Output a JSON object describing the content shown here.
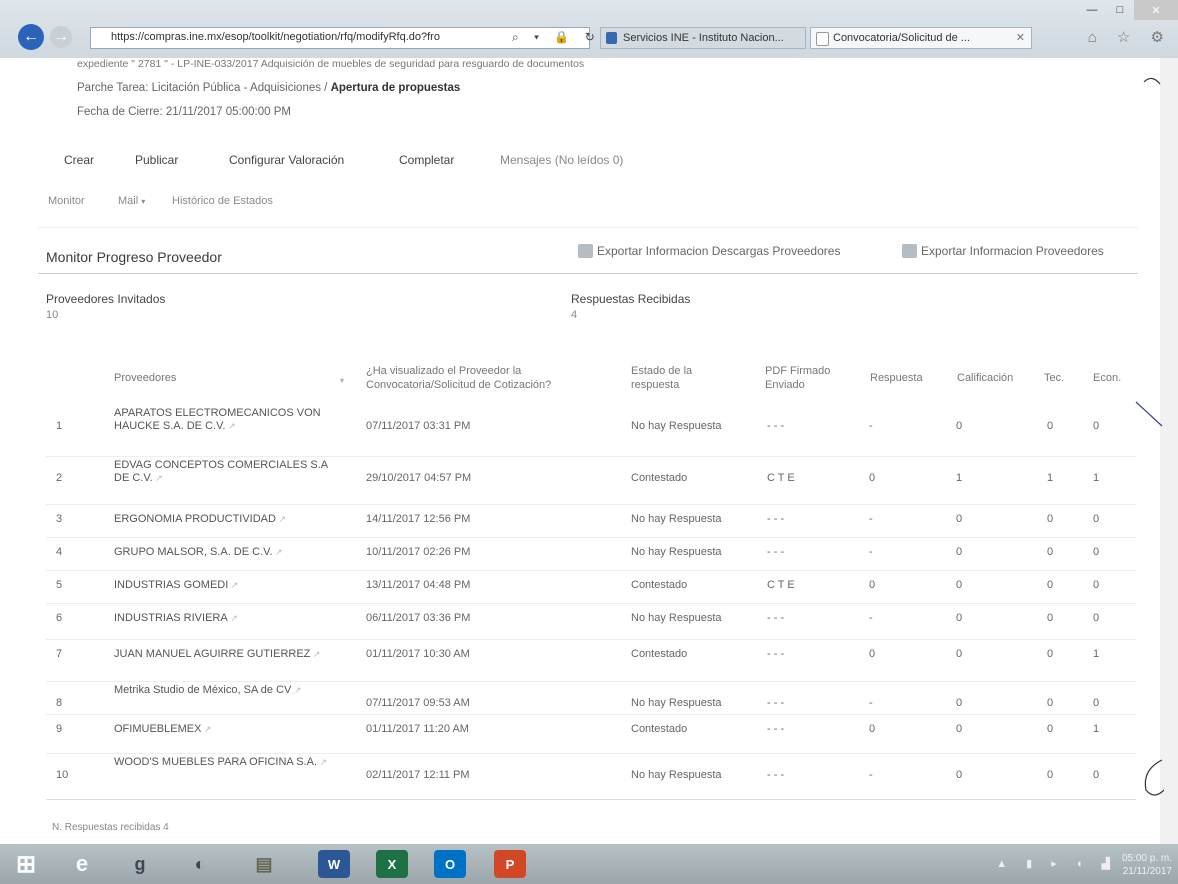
{
  "browser": {
    "url": "https://compras.ine.mx/esop/toolkit/negotiation/rfq/modifyRfq.do?fro",
    "tabs": [
      {
        "label": "Servicios INE - Instituto Nacion..."
      },
      {
        "label": "Convocatoria/Solicitud de ...",
        "close": "✕"
      }
    ],
    "address_controls": "⌕ ▾ 🔒 ↻",
    "toolbar_icons": "⌂ ☆ ⚙"
  },
  "header": {
    "expediente": "expediente \" 2781 \" - LP-INE-033/2017 Adquisición de muebles de seguridad para resguardo de documentos",
    "tarea_prefix": "Parche Tarea: Licitación Pública - Adquisiciones / ",
    "tarea_bold": "Apertura de propuestas",
    "fecha_cierre": "Fecha de Cierre: 21/11/2017 05:00:00 PM"
  },
  "menu": {
    "crear": "Crear",
    "publicar": "Publicar",
    "configurar": "Configurar Valoración",
    "completar": "Completar",
    "mensajes": "Mensajes (No leídos 0)"
  },
  "subnav": {
    "monitor": "Monitor",
    "mail": "Mail",
    "mail_arrow": "▾",
    "historico": "Histórico de Estados"
  },
  "section": {
    "title": "Monitor Progreso Proveedor",
    "export_descargas": "Exportar Informacion Descargas Proveedores",
    "export_proveedores": "Exportar Informacion Proveedores",
    "invitados_label": "Proveedores Invitados",
    "invitados_value": "10",
    "recibidas_label": "Respuestas Recibidas",
    "recibidas_value": "4"
  },
  "table": {
    "headers": {
      "proveedores": "Proveedores",
      "visualizado": "¿Ha visualizado el Proveedor la Convocatoria/Solicitud de Cotización?",
      "estado": "Estado de la respuesta",
      "pdf": "PDF Firmado Enviado",
      "respuesta": "Respuesta",
      "calificacion": "Calificación",
      "tec": "Tec.",
      "econ": "Econ."
    },
    "rows": [
      {
        "n": "1",
        "name": "APARATOS ELECTROMECANICOS VON HAUCKE S.A. DE C.V.",
        "fecha": "07/11/2017 03:31 PM",
        "estado": "No hay Respuesta",
        "pdf": "- - -",
        "resp": "-",
        "calif": "0",
        "tec": "0",
        "econ": "0"
      },
      {
        "n": "2",
        "name": "EDVAG CONCEPTOS COMERCIALES S.A DE C.V.",
        "fecha": "29/10/2017 04:57 PM",
        "estado": "Contestado",
        "pdf": "C T E",
        "resp": "0",
        "calif": "1",
        "tec": "1",
        "econ": "1"
      },
      {
        "n": "3",
        "name": "ERGONOMIA PRODUCTIVIDAD",
        "fecha": "14/11/2017 12:56 PM",
        "estado": "No hay Respuesta",
        "pdf": "- - -",
        "resp": "-",
        "calif": "0",
        "tec": "0",
        "econ": "0"
      },
      {
        "n": "4",
        "name": "GRUPO MALSOR, S.A. DE C.V.",
        "fecha": "10/11/2017 02:26 PM",
        "estado": "No hay Respuesta",
        "pdf": "- - -",
        "resp": "-",
        "calif": "0",
        "tec": "0",
        "econ": "0"
      },
      {
        "n": "5",
        "name": "INDUSTRIAS GOMEDI",
        "fecha": "13/11/2017 04:48 PM",
        "estado": "Contestado",
        "pdf": "C T E",
        "resp": "0",
        "calif": "0",
        "tec": "0",
        "econ": "0"
      },
      {
        "n": "6",
        "name": "INDUSTRIAS RIVIERA",
        "fecha": "06/11/2017 03:36 PM",
        "estado": "No hay Respuesta",
        "pdf": "- - -",
        "resp": "-",
        "calif": "0",
        "tec": "0",
        "econ": "0"
      },
      {
        "n": "7",
        "name": "JUAN MANUEL AGUIRRE GUTIERREZ",
        "fecha": "01/11/2017 10:30 AM",
        "estado": "Contestado",
        "pdf": "- - -",
        "resp": "0",
        "calif": "0",
        "tec": "0",
        "econ": "1"
      },
      {
        "n": "8",
        "name": "Metrika Studio de México, SA de CV",
        "fecha": "07/11/2017 09:53 AM",
        "estado": "No hay Respuesta",
        "pdf": "- - -",
        "resp": "-",
        "calif": "0",
        "tec": "0",
        "econ": "0"
      },
      {
        "n": "9",
        "name": "OFIMUEBLEMEX",
        "fecha": "01/11/2017 11:20 AM",
        "estado": "Contestado",
        "pdf": "- - -",
        "resp": "0",
        "calif": "0",
        "tec": "0",
        "econ": "1"
      },
      {
        "n": "10",
        "name": "WOOD'S MUEBLES PARA OFICINA S.A.",
        "fecha": "02/11/2017 12:11 PM",
        "estado": "No hay Respuesta",
        "pdf": "- - -",
        "resp": "-",
        "calif": "0",
        "tec": "0",
        "econ": "0"
      }
    ]
  },
  "footer": "N. Respuestas recibidas 4",
  "taskbar": {
    "items": [
      "⊞",
      "e",
      "g",
      "◐",
      "▤",
      "W",
      "X",
      "O",
      "P"
    ],
    "tray": "▲ ▮ ▸ ◖ ▟",
    "time": "05:00 p. m.",
    "date": "21/11/2017"
  },
  "colors": {
    "taskbar": "#9aa6aa",
    "back_button": "#2a63b8",
    "word": "#2b5797",
    "excel": "#1e7145",
    "outlook": "#0072c6",
    "powerpoint": "#d24726"
  }
}
